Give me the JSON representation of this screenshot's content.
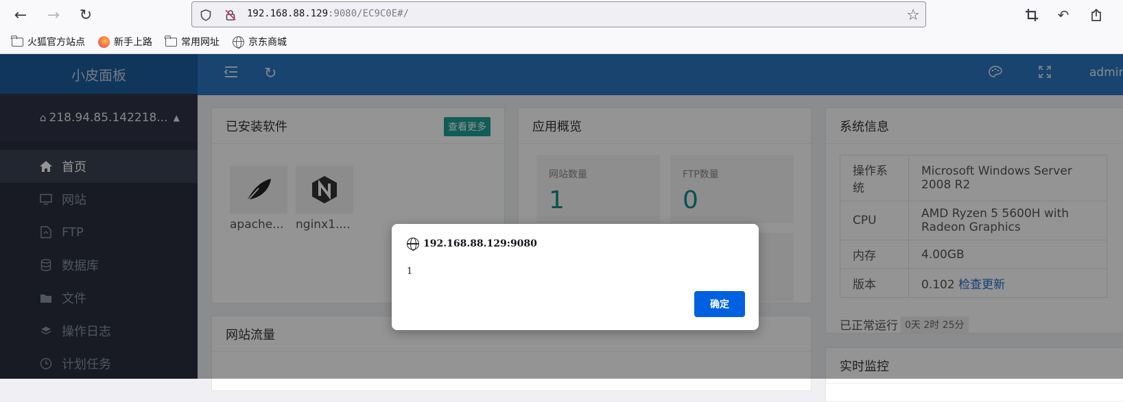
{
  "browser": {
    "url_host": "192.168.88.129",
    "url_rest": ":9080/EC9C0E#/",
    "bookmarks": [
      {
        "label": "火狐官方站点",
        "icon": "folder-icon"
      },
      {
        "label": "新手上路",
        "icon": "firefox-icon"
      },
      {
        "label": "常用网址",
        "icon": "folder-icon"
      },
      {
        "label": "京东商城",
        "icon": "globe-icon"
      }
    ]
  },
  "app": {
    "brand": "小皮面板",
    "server": "218.94.85.142218...",
    "user": "admin",
    "menu": [
      {
        "label": "首页",
        "icon": "home-icon",
        "active": true
      },
      {
        "label": "网站",
        "icon": "monitor-icon"
      },
      {
        "label": "FTP",
        "icon": "ftp-icon"
      },
      {
        "label": "数据库",
        "icon": "database-icon"
      },
      {
        "label": "文件",
        "icon": "folder-icon"
      },
      {
        "label": "操作日志",
        "icon": "layers-icon"
      },
      {
        "label": "计划任务",
        "icon": "clock-icon"
      }
    ]
  },
  "installed": {
    "title": "已安装软件",
    "more": "查看更多",
    "items": [
      {
        "name": "apache...",
        "icon": "apache-feather-icon"
      },
      {
        "name": "nginx1....",
        "icon": "nginx-icon"
      }
    ]
  },
  "overview": {
    "title": "应用概览",
    "stats": [
      {
        "label": "网站数量",
        "value": "1"
      },
      {
        "label": "FTP数量",
        "value": "0"
      }
    ]
  },
  "sysinfo": {
    "title": "系统信息",
    "rows": [
      {
        "key": "操作系统",
        "value": "Microsoft Windows Server 2008 R2"
      },
      {
        "key": "CPU",
        "value": "AMD Ryzen 5 5600H with Radeon Graphics"
      },
      {
        "key": "内存",
        "value": "4.00GB"
      },
      {
        "key": "版本",
        "value": "0.102",
        "link": "检查更新"
      }
    ],
    "uptime_label": "已正常运行",
    "uptime_value": "0天 2时 25分"
  },
  "traffic": {
    "title": "网站流量"
  },
  "monitor": {
    "title": "实时监控"
  },
  "dialog": {
    "origin": "192.168.88.129:9080",
    "message": "1",
    "ok": "确定"
  }
}
